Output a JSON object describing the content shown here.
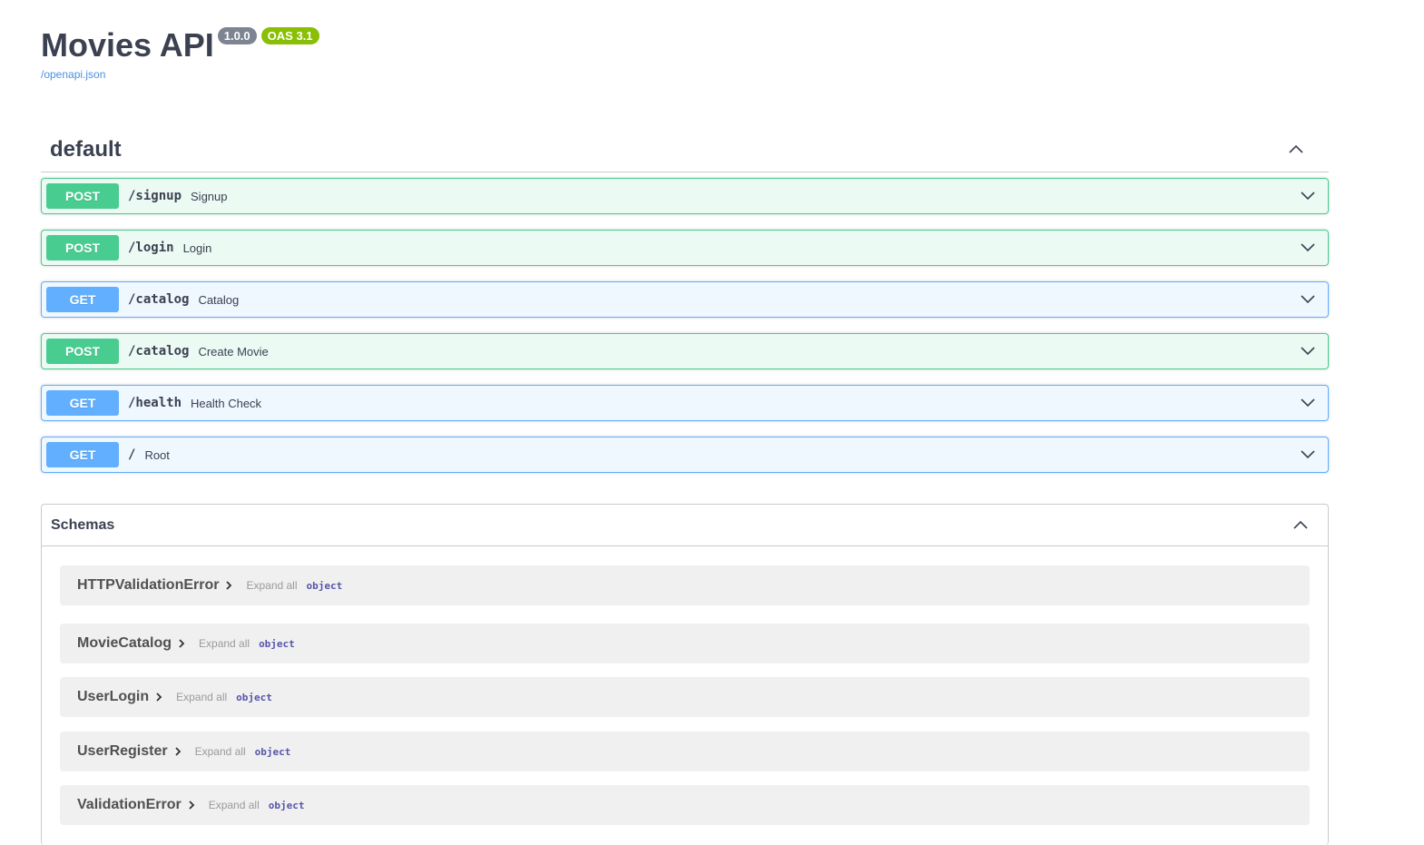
{
  "info": {
    "title": "Movies API",
    "version": "1.0.0",
    "oas": "OAS 3.1",
    "spec_link": "/openapi.json"
  },
  "tag": {
    "name": "default"
  },
  "operations": [
    {
      "method": "POST",
      "path": "/signup",
      "summary": "Signup"
    },
    {
      "method": "POST",
      "path": "/login",
      "summary": "Login"
    },
    {
      "method": "GET",
      "path": "/catalog",
      "summary": "Catalog"
    },
    {
      "method": "POST",
      "path": "/catalog",
      "summary": "Create Movie"
    },
    {
      "method": "GET",
      "path": "/health",
      "summary": "Health Check"
    },
    {
      "method": "GET",
      "path": "/",
      "summary": "Root"
    }
  ],
  "schemas": {
    "title": "Schemas",
    "expand_label": "Expand all",
    "models": [
      {
        "name": "HTTPValidationError",
        "type": "object"
      },
      {
        "name": "MovieCatalog",
        "type": "object"
      },
      {
        "name": "UserLogin",
        "type": "object"
      },
      {
        "name": "UserRegister",
        "type": "object"
      },
      {
        "name": "ValidationError",
        "type": "object"
      }
    ]
  },
  "icons": {
    "collapse": "chevron-up-icon",
    "expand": "chevron-down-icon",
    "model_arrow": "chevron-right-icon"
  },
  "colors": {
    "post": "#49cc90",
    "get": "#61affe",
    "version_badge": "#7d8492",
    "oas_badge": "#89bf04",
    "link": "#4990e2"
  }
}
